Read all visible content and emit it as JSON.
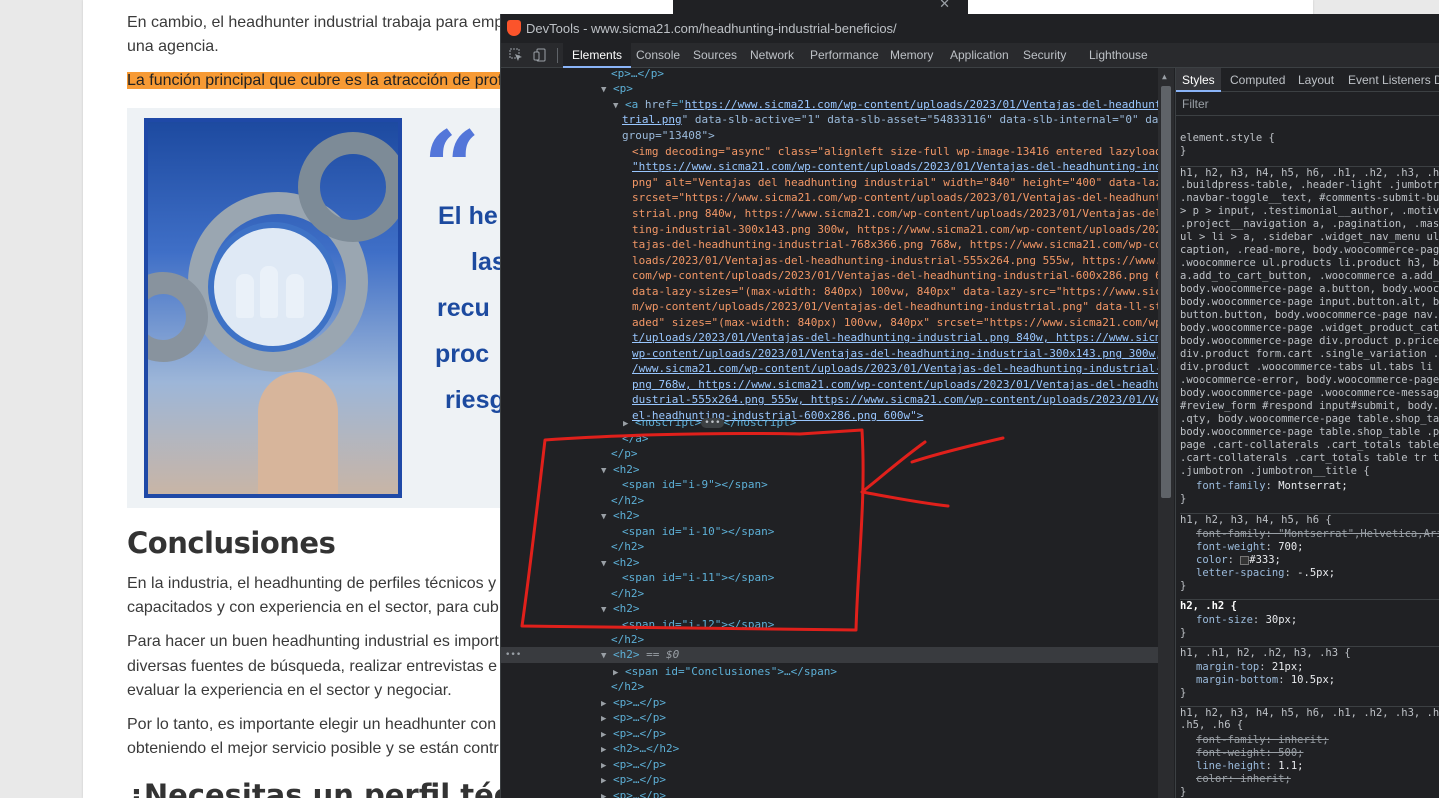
{
  "page": {
    "p1_line1": "En cambio, el headhunter industrial trabaja para emp",
    "p1_line2": "una agencia.",
    "highlight": "La función principal que cubre es la atracción de prof",
    "figure": {
      "quote": "“",
      "lines": [
        "El he",
        "las",
        "recu",
        "proc",
        "riesg"
      ]
    },
    "h2": "Conclusiones",
    "p2_line1": "En la industria, el headhunting de perfiles técnicos y",
    "p2_line2": "capacitados y con experiencia en el sector, para cub",
    "p3_line1": "Para hacer un buen headhunting industrial es import",
    "p3_line2": "diversas fuentes de búsqueda, realizar entrevistas e",
    "p3_line3": "evaluar la experiencia en el sector y negociar.",
    "p4_line1": "Por lo tanto, es importante elegir un headhunter con",
    "p4_line2": "obteniendo el mejor servicio posible y se están contr",
    "h2_next": "¿Necesitas un perfil técn"
  },
  "bgwin": {
    "close": "✕"
  },
  "devtools": {
    "title": "DevTools - www.sicma21.com/headhunting-industrial-beneficios/",
    "tabs": [
      "Elements",
      "Console",
      "Sources",
      "Network",
      "Performance",
      "Memory",
      "Application",
      "Security",
      "Lighthouse"
    ],
    "active_tab": "Elements",
    "styles_tabs": [
      "Styles",
      "Computed",
      "Layout",
      "Event Listeners",
      "D"
    ],
    "filter_placeholder": "Filter",
    "dom": {
      "l0": "<p>…</p>",
      "a_href": "https://www.sicma21.com/wp-content/uploads/2023/01/Ventajas-del-headhunting-indus",
      "a_href2": "trial.png",
      "a_rest1": "\" data-slb-active=\"1\" data-slb-asset=\"54833116\" data-slb-internal=\"0\" data-slb-",
      "a_rest2": "group=\"13408\">",
      "img1": "<img decoding=\"async\" class=\"alignleft size-full wp-image-13416 entered lazyloaded\" src=",
      "img2": "\"https://www.sicma21.com/wp-content/uploads/2023/01/Ventajas-del-headhunting-industrial.",
      "img3": "png\" alt=\"Ventajas del headhunting industrial\" width=\"840\" height=\"400\" data-lazy-",
      "img4": "srcset=\"https://www.sicma21.com/wp-content/uploads/2023/01/Ventajas-del-headhunting-indu",
      "img5": "strial.png 840w, https://www.sicma21.com/wp-content/uploads/2023/01/Ventajas-del-headhun",
      "img6": "ting-industrial-300x143.png 300w, https://www.sicma21.com/wp-content/uploads/2023/01/Ven",
      "img7": "tajas-del-headhunting-industrial-768x366.png 768w, https://www.sicma21.com/wp-content/up",
      "img8": "loads/2023/01/Ventajas-del-headhunting-industrial-555x264.png 555w, https://www.sicma21.",
      "img9": "com/wp-content/uploads/2023/01/Ventajas-del-headhunting-industrial-600x286.png 600w\"",
      "img10": "data-lazy-sizes=\"(max-width: 840px) 100vw, 840px\" data-lazy-src=\"https://www.sicma21.co",
      "img11": "m/wp-content/uploads/2023/01/Ventajas-del-headhunting-industrial.png\" data-ll-status=\"lo",
      "img12": "aded\" sizes=\"(max-width: 840px) 100vw, 840px\" srcset=\"https://www.sicma21.com/wp-conten",
      "img13": "t/uploads/2023/01/Ventajas-del-headhunting-industrial.png 840w, https://www.sicma21.com/",
      "img14": "wp-content/uploads/2023/01/Ventajas-del-headhunting-industrial-300x143.png 300w, https:/",
      "img15": "/www.sicma21.com/wp-content/uploads/2023/01/Ventajas-del-headhunting-industrial-768x366.",
      "img16": "png 768w, https://www.sicma21.com/wp-content/uploads/2023/01/Ventajas-del-headhunting-in",
      "img17": "dustrial-555x264.png 555w, https://www.sicma21.com/wp-content/uploads/2023/01/Ventajas-d",
      "img18": "el-headhunting-industrial-600x286.png 600w\">",
      "noscript": "<noscript>…</noscript>",
      "a_close": "</a>",
      "p_close": "</p>",
      "h2_open": "<h2>",
      "h2_close": "</h2>",
      "span_i9": "<span id=\"i-9\"></span>",
      "span_i10": "<span id=\"i-10\"></span>",
      "span_i11": "<span id=\"i-11\"></span>",
      "span_i12": "<span id=\"i-12\"></span>",
      "selected": "<h2>",
      "selected_eq": "== $0",
      "span_concl": "<span id=\"Conclusiones\">…</span>",
      "p_collapsed": "<p>…</p>",
      "h2_collapsed": "<h2>…</h2>"
    },
    "css": {
      "element_style": "element.style {",
      "close": "}",
      "rule1_sel": [
        "h1, h2, h3, h4, h5, h6, .h1, .h2, .h3, .h4,",
        ".buildpress-table, .header-light .jumbotron_",
        ".navbar-toggle__text, #comments-submit-butto",
        "> p > input, .testimonial__author, .motivati",
        ".project__navigation a, .pagination, .master",
        "ul > li > a, .sidebar .widget_nav_menu ul >",
        "caption, .read-more, body.woocommerce-page u",
        ".woocommerce ul.products li.product h3, body",
        "a.add_to_cart_button, .woocommerce a.add_to_",
        "body.woocommerce-page a.button, body.woocomm",
        "body.woocommerce-page input.button.alt, body",
        "button.button, body.woocommerce-page nav.woo",
        "body.woocommerce-page .widget_product_catego",
        "body.woocommerce-page div.product p.price, b",
        "div.product form.cart .single_variation .pri",
        "div.product .woocommerce-tabs ul.tabs li a,",
        ".woocommerce-error, body.woocommerce-page .w",
        "body.woocommerce-page .woocommerce-message,",
        "#review_form #respond input#submit, body.woo",
        ".qty, body.woocommerce-page table.shop_table",
        "body.woocommerce-page table.shop_table .prod",
        "page .cart-collaterals .cart_totals table tr",
        ".cart-collaterals .cart_totals table tr td,",
        ".jumbotron .jumbotron__title {"
      ],
      "rule1_prop": "font-family",
      "rule1_val": "Montserrat;",
      "rule2_sel": "h1, h2, h3, h4, h5, h6 {",
      "rule2_p1": "font-family: \"Montserrat\",Helvetica,Arial",
      "rule2_p2_k": "font-weight",
      "rule2_p2_v": "700;",
      "rule2_p3_k": "color",
      "rule2_p3_v": "#333;",
      "rule2_p4_k": "letter-spacing",
      "rule2_p4_v": "-.5px;",
      "rule3_sel": "h2, .h2 {",
      "rule3_k": "font-size",
      "rule3_v": "30px;",
      "rule4_sel": "h1, .h1, h2, .h2, h3, .h3 {",
      "rule4_p1_k": "margin-top",
      "rule4_p1_v": "21px;",
      "rule4_p2_k": "margin-bottom",
      "rule4_p2_v": "10.5px;",
      "rule5_sel1": "h1, h2, h3, h4, h5, h6, .h1, .h2, .h3, .h4,",
      "rule5_sel2": ".h5, .h6 {",
      "rule5_p1": "font-family: inherit;",
      "rule5_p2": "font-weight: 500;",
      "rule5_p3_k": "line-height",
      "rule5_p3_v": "1.1;",
      "rule5_p4": "color: inherit;",
      "rule6_sel": "* {"
    }
  },
  "colors": {
    "highlight": "#f79a34",
    "annotation": "#e0201b",
    "devtools_bg": "#202124"
  }
}
